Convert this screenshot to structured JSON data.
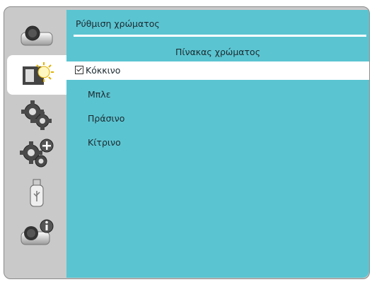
{
  "colors": {
    "panel": "#5bc4d1",
    "frame": "#c9c9c9",
    "selected_row": "#ffffff"
  },
  "sidebar": {
    "items": [
      {
        "icon": "projector-icon"
      },
      {
        "icon": "display-settings-icon",
        "active": true
      },
      {
        "icon": "gears-icon"
      },
      {
        "icon": "gears-plus-icon"
      },
      {
        "icon": "usb-icon"
      },
      {
        "icon": "projector-info-icon"
      }
    ]
  },
  "menu": {
    "title": "Ρύθμιση χρώματος",
    "subtitle": "Πίνακας χρώματος",
    "options": [
      {
        "label": "Κόκκινο",
        "checked": true
      },
      {
        "label": "Μπλε"
      },
      {
        "label": "Πράσινο"
      },
      {
        "label": "Κίτρινο"
      }
    ]
  }
}
